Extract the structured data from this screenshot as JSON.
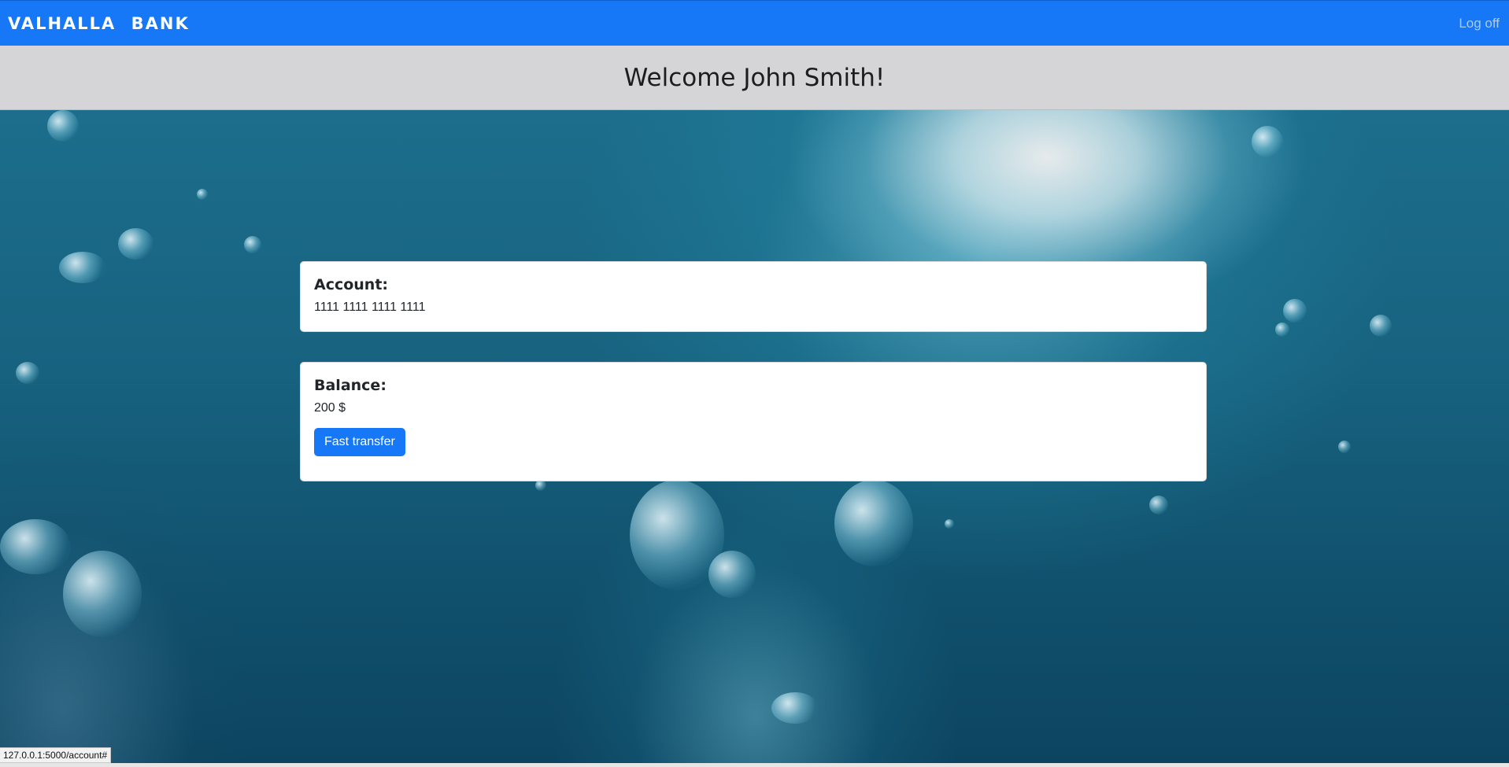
{
  "navbar": {
    "brand": "VALHALLA  BANK",
    "logoff_label": "Log off"
  },
  "header": {
    "welcome_text": "Welcome John Smith!"
  },
  "account_card": {
    "title": "Account:",
    "number": "1111 1111 1111 1111"
  },
  "balance_card": {
    "title": "Balance:",
    "amount": "200 $",
    "transfer_button_label": "Fast transfer"
  },
  "status": {
    "url": "127.0.0.1:5000/account#"
  },
  "colors": {
    "primary": "#1677f7",
    "header_bg": "#d5d5d7",
    "card_bg": "#ffffff"
  }
}
